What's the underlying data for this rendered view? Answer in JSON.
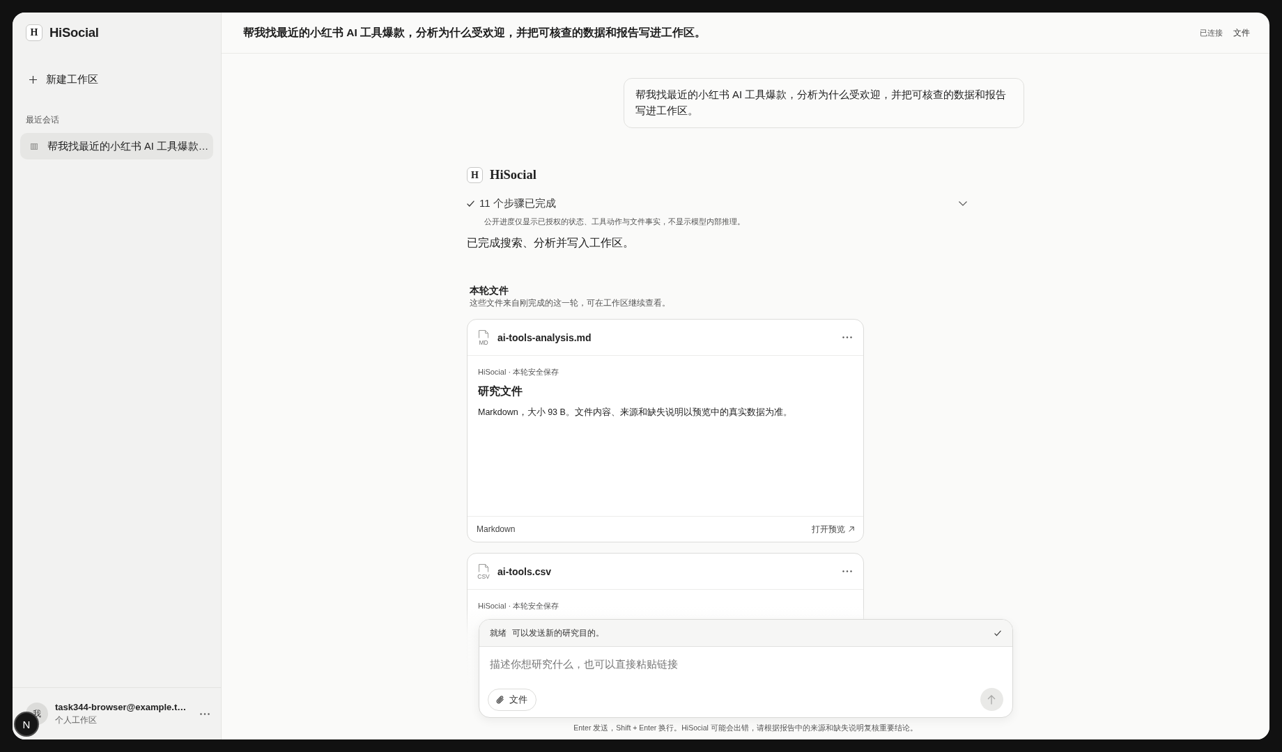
{
  "sidebar": {
    "brand": {
      "mark": "H",
      "name": "HiSocial"
    },
    "new_workspace": {
      "label": "新建工作区"
    },
    "section_label": "最近会话",
    "conversations": [
      {
        "title": "帮我找最近的小红书 AI 工具爆款…",
        "selected": true
      }
    ],
    "user": {
      "avatar": "我",
      "name": "task344-browser@example.t…",
      "workspace": "个人工作区"
    }
  },
  "header": {
    "title": "帮我找最近的小红书 AI 工具爆款，分析为什么受欢迎，并把可核查的数据和报告写进工作区。",
    "status": "已连接",
    "files_link": "文件"
  },
  "conversation": {
    "user_message": "帮我找最近的小红书 AI 工具爆款，分析为什么受欢迎，并把可核查的数据和报告写进工作区。",
    "assistant": {
      "mark": "H",
      "name": "HiSocial",
      "steps": {
        "label": "11 个步骤已完成",
        "done": true,
        "expanded": false,
        "note": "公开进度仅显示已授权的状态、工具动作与文件事实，不显示模型内部推理。"
      },
      "reply": "已完成搜索、分析并写入工作区。"
    },
    "files_section": {
      "title": "本轮文件",
      "subtitle": "这些文件来自刚完成的这一轮，可在工作区继续查看。"
    },
    "files": [
      {
        "name": "ai-tools-analysis.md",
        "type_label": "MD",
        "source": "HiSocial · 本轮安全保存",
        "title": "研究文件",
        "description": "Markdown，大小 93 B。文件内容、来源和缺失说明以预览中的真实数据为准。",
        "format": "Markdown",
        "action": "打开预览"
      },
      {
        "name": "ai-tools.csv",
        "type_label": "CSV",
        "source": "HiSocial · 本轮安全保存"
      }
    ]
  },
  "composer": {
    "status": {
      "label": "就绪",
      "message": "可以发送新的研究目的。",
      "ok": true
    },
    "placeholder": "描述你想研究什么，也可以直接粘贴链接",
    "attach_label": "文件",
    "send": {
      "disabled": true
    },
    "hint": "Enter 发送，Shift + Enter 换行。HiSocial 可能会出错，请根据报告中的来源和缺失说明复核重要结论。"
  },
  "dev_indicator": {
    "label": "N"
  }
}
